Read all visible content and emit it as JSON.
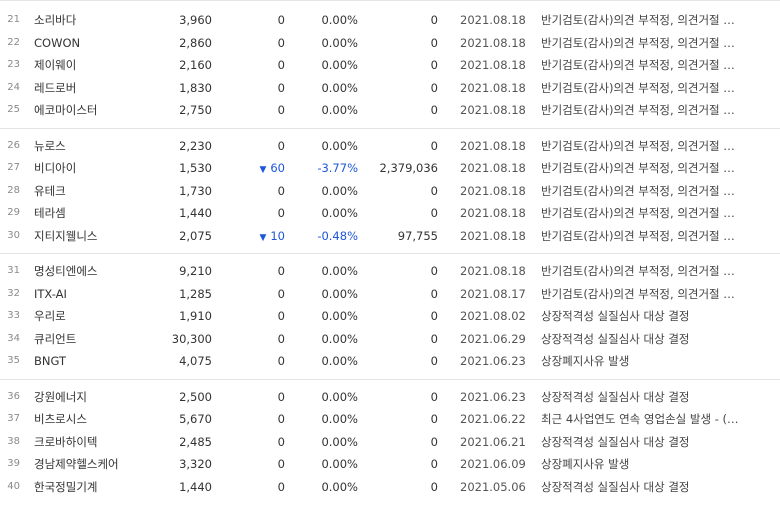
{
  "colors": {
    "down": "#1e56d9",
    "text": "#333333",
    "divider": "#e4e4e4"
  },
  "groups": [
    {
      "rows": [
        {
          "no": "21",
          "name": "소리바다",
          "price": "3,960",
          "change": "0",
          "dir": "flat",
          "rate": "0.00%",
          "volume": "0",
          "date": "2021.08.18",
          "reason": "반기검토(감사)의견 부적정, 의견거절 …"
        },
        {
          "no": "22",
          "name": "COWON",
          "price": "2,860",
          "change": "0",
          "dir": "flat",
          "rate": "0.00%",
          "volume": "0",
          "date": "2021.08.18",
          "reason": "반기검토(감사)의견 부적정, 의견거절 …"
        },
        {
          "no": "23",
          "name": "제이웨이",
          "price": "2,160",
          "change": "0",
          "dir": "flat",
          "rate": "0.00%",
          "volume": "0",
          "date": "2021.08.18",
          "reason": "반기검토(감사)의견 부적정, 의견거절 …"
        },
        {
          "no": "24",
          "name": "레드로버",
          "price": "1,830",
          "change": "0",
          "dir": "flat",
          "rate": "0.00%",
          "volume": "0",
          "date": "2021.08.18",
          "reason": "반기검토(감사)의견 부적정, 의견거절 …"
        },
        {
          "no": "25",
          "name": "에코마이스터",
          "price": "2,750",
          "change": "0",
          "dir": "flat",
          "rate": "0.00%",
          "volume": "0",
          "date": "2021.08.18",
          "reason": "반기검토(감사)의견 부적정, 의견거절 …"
        }
      ]
    },
    {
      "rows": [
        {
          "no": "26",
          "name": "뉴로스",
          "price": "2,230",
          "change": "0",
          "dir": "flat",
          "rate": "0.00%",
          "volume": "0",
          "date": "2021.08.18",
          "reason": "반기검토(감사)의견 부적정, 의견거절 …"
        },
        {
          "no": "27",
          "name": "비디아이",
          "price": "1,530",
          "change": "60",
          "dir": "down",
          "rate": "-3.77%",
          "volume": "2,379,036",
          "date": "2021.08.18",
          "reason": "반기검토(감사)의견 부적정, 의견거절 …"
        },
        {
          "no": "28",
          "name": "유테크",
          "price": "1,730",
          "change": "0",
          "dir": "flat",
          "rate": "0.00%",
          "volume": "0",
          "date": "2021.08.18",
          "reason": "반기검토(감사)의견 부적정, 의견거절 …"
        },
        {
          "no": "29",
          "name": "테라셈",
          "price": "1,440",
          "change": "0",
          "dir": "flat",
          "rate": "0.00%",
          "volume": "0",
          "date": "2021.08.18",
          "reason": "반기검토(감사)의견 부적정, 의견거절 …"
        },
        {
          "no": "30",
          "name": "지티지웰니스",
          "price": "2,075",
          "change": "10",
          "dir": "down",
          "rate": "-0.48%",
          "volume": "97,755",
          "date": "2021.08.18",
          "reason": "반기검토(감사)의견 부적정, 의견거절 …"
        }
      ]
    },
    {
      "rows": [
        {
          "no": "31",
          "name": "명성티엔에스",
          "price": "9,210",
          "change": "0",
          "dir": "flat",
          "rate": "0.00%",
          "volume": "0",
          "date": "2021.08.18",
          "reason": "반기검토(감사)의견 부적정, 의견거절 …"
        },
        {
          "no": "32",
          "name": "ITX-AI",
          "price": "1,285",
          "change": "0",
          "dir": "flat",
          "rate": "0.00%",
          "volume": "0",
          "date": "2021.08.17",
          "reason": "반기검토(감사)의견 부적정, 의견거절 …"
        },
        {
          "no": "33",
          "name": "우리로",
          "price": "1,910",
          "change": "0",
          "dir": "flat",
          "rate": "0.00%",
          "volume": "0",
          "date": "2021.08.02",
          "reason": "상장적격성 실질심사 대상 결정"
        },
        {
          "no": "34",
          "name": "큐리언트",
          "price": "30,300",
          "change": "0",
          "dir": "flat",
          "rate": "0.00%",
          "volume": "0",
          "date": "2021.06.29",
          "reason": "상장적격성 실질심사 대상 결정"
        },
        {
          "no": "35",
          "name": "BNGT",
          "price": "4,075",
          "change": "0",
          "dir": "flat",
          "rate": "0.00%",
          "volume": "0",
          "date": "2021.06.23",
          "reason": "상장폐지사유 발생"
        }
      ]
    },
    {
      "rows": [
        {
          "no": "36",
          "name": "강원에너지",
          "price": "2,500",
          "change": "0",
          "dir": "flat",
          "rate": "0.00%",
          "volume": "0",
          "date": "2021.06.23",
          "reason": "상장적격성 실질심사 대상 결정"
        },
        {
          "no": "37",
          "name": "비츠로시스",
          "price": "5,670",
          "change": "0",
          "dir": "flat",
          "rate": "0.00%",
          "volume": "0",
          "date": "2021.06.22",
          "reason": "최근 4사업연도 연속 영업손실 발생 - (…"
        },
        {
          "no": "38",
          "name": "크로바하이텍",
          "price": "2,485",
          "change": "0",
          "dir": "flat",
          "rate": "0.00%",
          "volume": "0",
          "date": "2021.06.21",
          "reason": "상장적격성 실질심사 대상 결정"
        },
        {
          "no": "39",
          "name": "경남제약헬스케어",
          "price": "3,320",
          "change": "0",
          "dir": "flat",
          "rate": "0.00%",
          "volume": "0",
          "date": "2021.06.09",
          "reason": "상장폐지사유 발생"
        },
        {
          "no": "40",
          "name": "한국정밀기계",
          "price": "1,440",
          "change": "0",
          "dir": "flat",
          "rate": "0.00%",
          "volume": "0",
          "date": "2021.05.06",
          "reason": "상장적격성 실질심사 대상 결정"
        }
      ]
    }
  ]
}
